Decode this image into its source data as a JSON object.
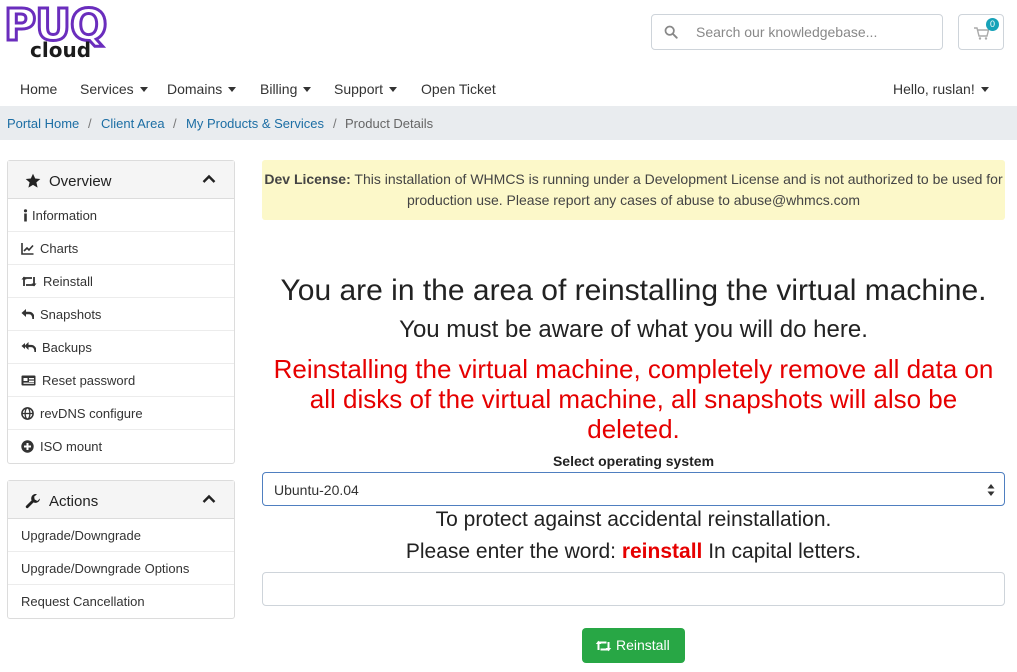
{
  "brand": {
    "logo_main": "PUQ",
    "logo_sub": "cloud",
    "accent": "#6a2dbd"
  },
  "search": {
    "placeholder": "Search our knowledgebase..."
  },
  "cart": {
    "count": "0"
  },
  "nav": {
    "items": [
      {
        "label": "Home"
      },
      {
        "label": "Services"
      },
      {
        "label": "Domains"
      },
      {
        "label": "Billing"
      },
      {
        "label": "Support"
      },
      {
        "label": "Open Ticket"
      }
    ],
    "user_greeting": "Hello, ruslan!"
  },
  "breadcrumb": {
    "items": [
      "Portal Home",
      "Client Area",
      "My Products & Services"
    ],
    "current": "Product Details",
    "separator": "/"
  },
  "sidebar": {
    "overview": {
      "title": "Overview",
      "items": [
        {
          "label": "Information",
          "icon": "info-icon"
        },
        {
          "label": "Charts",
          "icon": "chart-icon"
        },
        {
          "label": "Reinstall",
          "icon": "retweet-icon"
        },
        {
          "label": "Snapshots",
          "icon": "reply-icon"
        },
        {
          "label": "Backups",
          "icon": "reply-all-icon"
        },
        {
          "label": "Reset password",
          "icon": "id-card-icon"
        },
        {
          "label": "revDNS configure",
          "icon": "globe-icon"
        },
        {
          "label": "ISO mount",
          "icon": "plus-circle-icon"
        }
      ]
    },
    "actions": {
      "title": "Actions",
      "items": [
        {
          "label": "Upgrade/Downgrade"
        },
        {
          "label": "Upgrade/Downgrade Options"
        },
        {
          "label": "Request Cancellation"
        }
      ]
    }
  },
  "alert": {
    "strong": "Dev License:",
    "text": " This installation of WHMCS is running under a Development License and is not authorized to be used for production use. Please report any cases of abuse to abuse@whmcs.com"
  },
  "main": {
    "heading": "You are in the area of reinstalling the virtual machine.",
    "subheading": "You must be aware of what you will do here.",
    "warning": "Reinstalling the virtual machine, completely remove all data on all disks of the virtual machine, all snapshots will also be deleted.",
    "os_label": "Select operating system",
    "os_selected": "Ubuntu-20.04",
    "protect_text": "To protect against accidental reinstallation.",
    "enter_prefix": "Please enter the word: ",
    "keyword": "reinstall",
    "enter_suffix": " In capital letters.",
    "confirm_value": "",
    "button_label": "Reinstall"
  },
  "colors": {
    "link": "#1c6ea4",
    "danger": "#e60000",
    "success": "#28a745",
    "alert_bg": "#fcf8c9"
  }
}
